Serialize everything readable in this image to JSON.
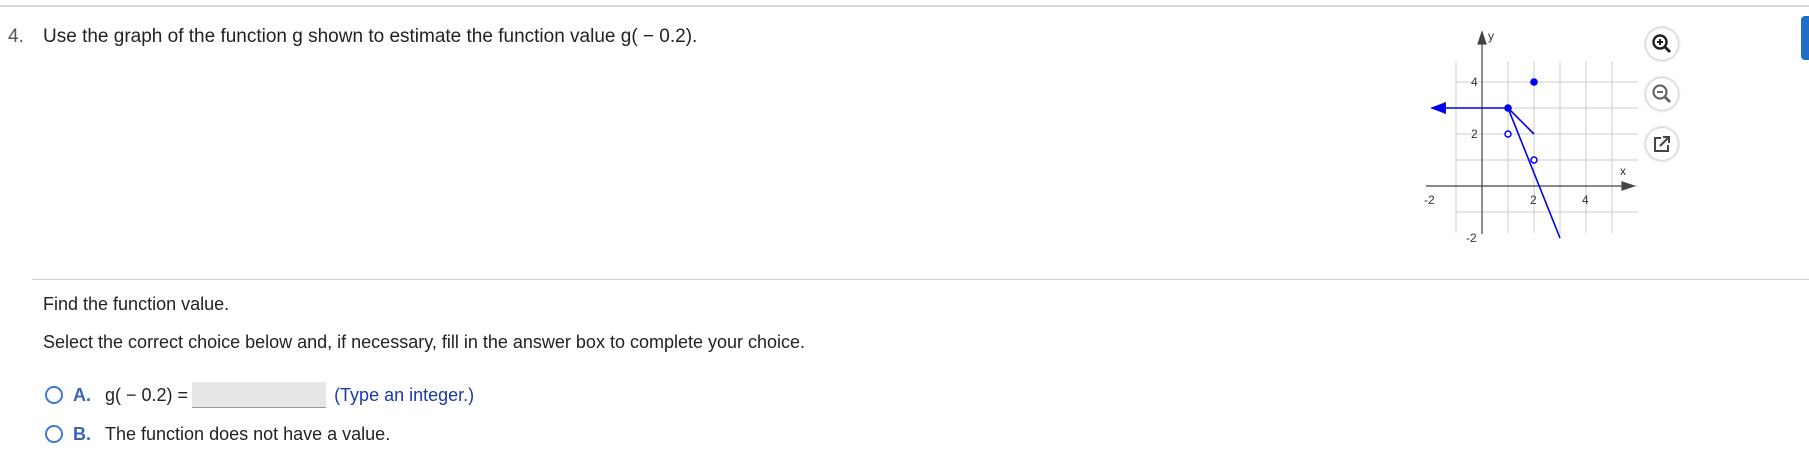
{
  "question": {
    "number": "4.",
    "text": "Use the graph of the function g shown to estimate the function value g( − 0.2)."
  },
  "graph": {
    "axis_x_label": "x",
    "axis_y_label": "y",
    "x_tick_labels": [
      "-2",
      "2",
      "4"
    ],
    "y_tick_labels": [
      "4",
      "2",
      "-2"
    ],
    "line_color": "#0000ee",
    "grid_color": "#cccccc",
    "segments": [
      {
        "from": [
          -2,
          3
        ],
        "to": [
          1,
          3
        ],
        "arrow_left": true
      },
      {
        "from": [
          1,
          3
        ],
        "to": [
          2,
          2
        ]
      },
      {
        "from": [
          1,
          3
        ],
        "to": [
          3,
          -2
        ]
      }
    ],
    "closed_points": [
      [
        1,
        3
      ],
      [
        2,
        4
      ]
    ],
    "open_points": [
      [
        1,
        2
      ],
      [
        2,
        1
      ]
    ]
  },
  "tools": {
    "zoom_in": "zoom-in-icon",
    "zoom_out": "zoom-out-icon",
    "popout": "popout-icon"
  },
  "instructions": {
    "find": "Find the function value.",
    "select": "Select the correct choice below and, if necessary, fill in the answer box to complete your choice."
  },
  "choices": [
    {
      "letter": "A.",
      "expr": "g( − 0.2) =",
      "hint": "(Type an integer.)",
      "answer_value": ""
    },
    {
      "letter": "B.",
      "text": "The function does not have a value."
    }
  ],
  "colors": {
    "accent": "#3a63b8",
    "hint": "#1a3aa0",
    "plot": "#0000ee"
  }
}
